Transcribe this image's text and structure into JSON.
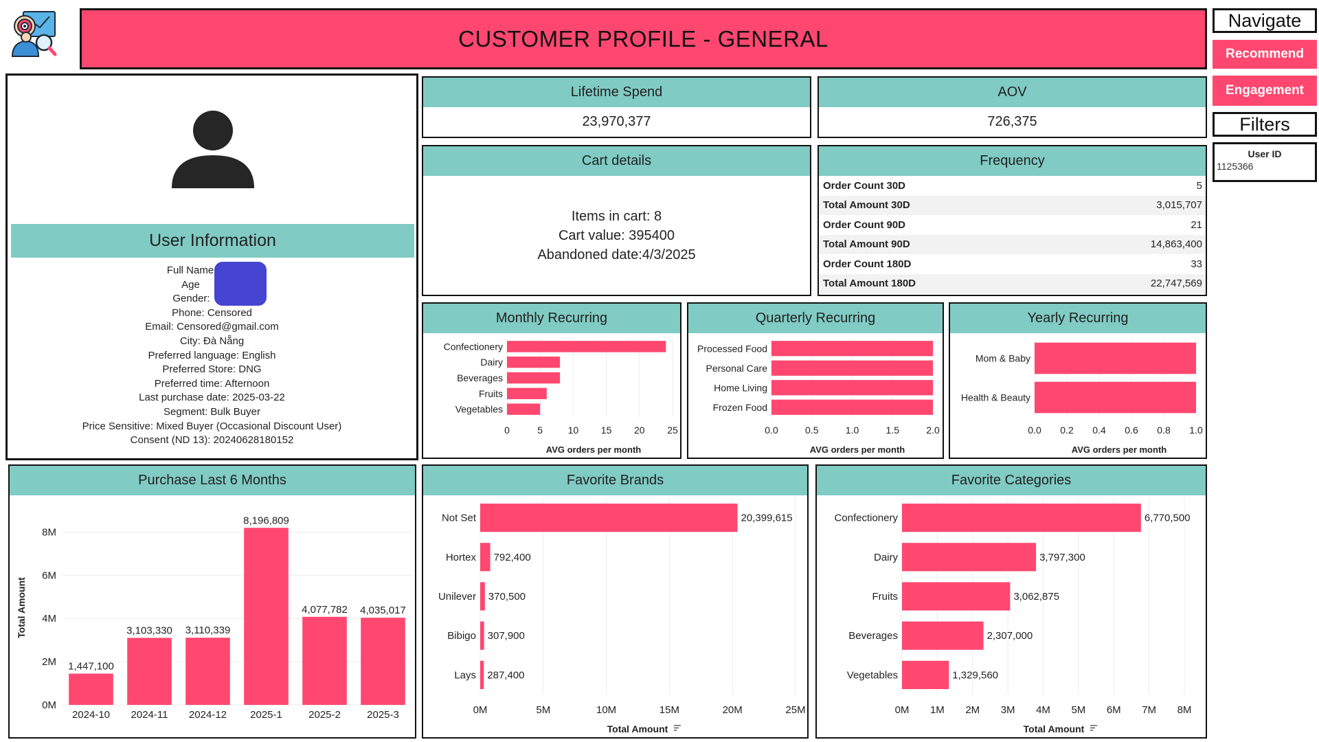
{
  "header": {
    "title": "CUSTOMER PROFILE - GENERAL",
    "logo_icon": "customer-analytics-icon"
  },
  "nav": {
    "navigate_label": "Navigate",
    "recommend_label": "Recommend",
    "engagement_label": "Engagement",
    "filters_label": "Filters",
    "user_id_label": "User ID",
    "user_id_value": "1125366"
  },
  "user_info": {
    "avatar_icon": "user-avatar-icon",
    "title": "User Information",
    "full_name": "Full Name",
    "age": "Age",
    "gender": "Gender:",
    "phone": "Phone: Censored",
    "email": "Email: Censored@gmail.com",
    "city": "City: Đà Nẵng",
    "language": "Preferred language: English",
    "store": "Preferred Store: DNG",
    "time": "Preferred time: Afternoon",
    "last_purchase": "Last purchase date: 2025-03-22",
    "segment": "Segment: Bulk Buyer",
    "price_sensitive": "Price Sensitive: Mixed Buyer (Occasional Discount User)",
    "consent": "Consent (ND 13): 20240628180152",
    "redaction_color": "#4545d1"
  },
  "kpi": {
    "lifetime_spend_label": "Lifetime Spend",
    "lifetime_spend_value": "23,970,377",
    "aov_label": "AOV",
    "aov_value": "726,375"
  },
  "cart": {
    "title": "Cart details",
    "items": "Items in cart: 8",
    "value": "Cart value: 395400",
    "abandoned": "Abandoned date:4/3/2025"
  },
  "frequency": {
    "title": "Frequency",
    "rows": [
      {
        "label": "Order Count 30D",
        "value": "5"
      },
      {
        "label": "Total Amount 30D",
        "value": "3,015,707"
      },
      {
        "label": "Order Count 90D",
        "value": "21"
      },
      {
        "label": "Total Amount 90D",
        "value": "14,863,400"
      },
      {
        "label": "Order Count 180D",
        "value": "33"
      },
      {
        "label": "Total Amount 180D",
        "value": "22,747,569"
      }
    ]
  },
  "colors": {
    "accent": "#ff4770",
    "teal": "#80cbc3"
  },
  "chart_data": [
    {
      "id": "monthly",
      "type": "bar",
      "orientation": "horizontal",
      "title": "Monthly Recurring",
      "xlabel": "AVG orders per month",
      "categories": [
        "Confectionery",
        "Dairy",
        "Beverages",
        "Fruits",
        "Vegetables"
      ],
      "values": [
        24,
        8,
        8,
        6,
        5
      ],
      "xlim": [
        0,
        25
      ],
      "ticks": [
        0,
        5,
        10,
        15,
        20,
        25
      ],
      "tick_labels": [
        "0",
        "5",
        "10",
        "15",
        "20",
        "25"
      ]
    },
    {
      "id": "quarterly",
      "type": "bar",
      "orientation": "horizontal",
      "title": "Quarterly Recurring",
      "xlabel": "AVG orders per month",
      "categories": [
        "Processed Food",
        "Personal Care",
        "Home Living",
        "Frozen Food"
      ],
      "values": [
        2.0,
        2.0,
        2.0,
        2.0
      ],
      "xlim": [
        0,
        2.0
      ],
      "ticks": [
        0,
        0.5,
        1.0,
        1.5,
        2.0
      ],
      "tick_labels": [
        "0.0",
        "0.5",
        "1.0",
        "1.5",
        "2.0"
      ]
    },
    {
      "id": "yearly",
      "type": "bar",
      "orientation": "horizontal",
      "title": "Yearly Recurring",
      "xlabel": "AVG orders per month",
      "categories": [
        "Mom & Baby",
        "Health & Beauty"
      ],
      "values": [
        1.0,
        1.0
      ],
      "xlim": [
        0,
        1.0
      ],
      "ticks": [
        0,
        0.2,
        0.4,
        0.6,
        0.8,
        1.0
      ],
      "tick_labels": [
        "0.0",
        "0.2",
        "0.4",
        "0.6",
        "0.8",
        "1.0"
      ]
    },
    {
      "id": "purchase6m",
      "type": "bar",
      "orientation": "vertical",
      "title": "Purchase Last 6 Months",
      "ylabel": "Total Amount",
      "categories": [
        "2024-10",
        "2024-11",
        "2024-12",
        "2025-1",
        "2025-2",
        "2025-3"
      ],
      "values": [
        1447100,
        3103330,
        3110339,
        8196809,
        4077782,
        4035017
      ],
      "value_labels": [
        "1,447,100",
        "3,103,330",
        "3,110,339",
        "8,196,809",
        "4,077,782",
        "4,035,017"
      ],
      "ylim": [
        0,
        9000000
      ],
      "ticks": [
        0,
        2000000,
        4000000,
        6000000,
        8000000
      ],
      "tick_labels": [
        "0M",
        "2M",
        "4M",
        "6M",
        "8M"
      ]
    },
    {
      "id": "brands",
      "type": "bar",
      "orientation": "horizontal",
      "title": "Favorite Brands",
      "xlabel": "Total Amount",
      "categories": [
        "Not Set",
        "Hortex",
        "Unilever",
        "Bibigo",
        "Lays"
      ],
      "values": [
        20399615,
        792400,
        370500,
        307900,
        287400
      ],
      "value_labels": [
        "20,399,615",
        "792,400",
        "370,500",
        "307,900",
        "287,400"
      ],
      "xlim": [
        0,
        25000000
      ],
      "ticks": [
        0,
        5000000,
        10000000,
        15000000,
        20000000,
        25000000
      ],
      "tick_labels": [
        "0M",
        "5M",
        "10M",
        "15M",
        "20M",
        "25M"
      ]
    },
    {
      "id": "categories",
      "type": "bar",
      "orientation": "horizontal",
      "title": "Favorite Categories",
      "xlabel": "Total Amount",
      "categories": [
        "Confectionery",
        "Dairy",
        "Fruits",
        "Beverages",
        "Vegetables"
      ],
      "values": [
        6770500,
        3797300,
        3062875,
        2307000,
        1329560
      ],
      "value_labels": [
        "6,770,500",
        "3,797,300",
        "3,062,875",
        "2,307,000",
        "1,329,560"
      ],
      "xlim": [
        0,
        8000000
      ],
      "ticks": [
        0,
        1000000,
        2000000,
        3000000,
        4000000,
        5000000,
        6000000,
        7000000,
        8000000
      ],
      "tick_labels": [
        "0M",
        "1M",
        "2M",
        "3M",
        "4M",
        "5M",
        "6M",
        "7M",
        "8M"
      ]
    }
  ]
}
